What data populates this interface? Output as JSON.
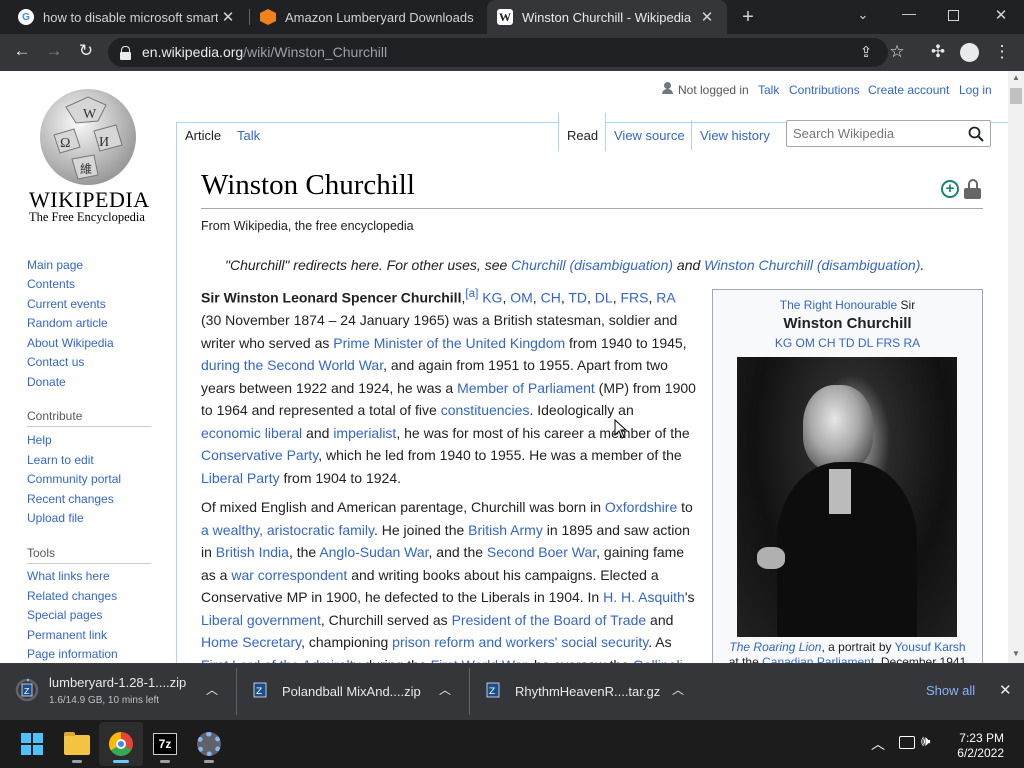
{
  "browser": {
    "tabs": [
      {
        "title": "how to disable microsoft smartsc",
        "icon": "google-icon"
      },
      {
        "title": "Amazon Lumberyard Downloads",
        "icon": "lumberyard-icon"
      },
      {
        "title": "Winston Churchill - Wikipedia",
        "icon": "wikipedia-icon"
      }
    ],
    "new_tab": "+",
    "url_host": "en.wikipedia.org",
    "url_path": "/wiki/Winston_Churchill"
  },
  "wiki": {
    "logo_word": "WIKIPEDIA",
    "logo_tagline": "The Free Encyclopedia",
    "user": {
      "status": "Not logged in",
      "talk": "Talk",
      "contributions": "Contributions",
      "create": "Create account",
      "login": "Log in"
    },
    "tabs": {
      "article": "Article",
      "talk": "Talk",
      "read": "Read",
      "view_source": "View source",
      "view_history": "View history"
    },
    "search_placeholder": "Search Wikipedia",
    "nav": [
      "Main page",
      "Contents",
      "Current events",
      "Random article",
      "About Wikipedia",
      "Contact us",
      "Donate"
    ],
    "contribute_heading": "Contribute",
    "contribute": [
      "Help",
      "Learn to edit",
      "Community portal",
      "Recent changes",
      "Upload file"
    ],
    "tools_heading": "Tools",
    "tools": [
      "What links here",
      "Related changes",
      "Special pages",
      "Permanent link",
      "Page information"
    ],
    "title": "Winston Churchill",
    "tagline": "From Wikipedia, the free encyclopedia",
    "hatnote": {
      "a": "\"Churchill\" redirects here. For other uses, see ",
      "l1": "Churchill (disambiguation)",
      "b": " and ",
      "l2": "Winston Churchill (disambiguation)",
      "c": "."
    },
    "infobox": {
      "honorific": "The Right Honourable",
      "sir": " Sir",
      "name": "Winston Churchill",
      "postnominals": "KG OM CH TD DL FRS RA",
      "caption_link1": "The Roaring Lion",
      "caption_mid": ", a portrait by ",
      "caption_link2": "Yousuf Karsh",
      "caption_2a": "at the ",
      "caption_link3": "Canadian Parliament",
      "caption_2b": ", December 1941"
    }
  },
  "downloads": {
    "items": [
      {
        "name": "lumberyard-1.28-1....zip",
        "status": "1.6/14.9 GB, 10 mins left"
      },
      {
        "name": "Polandball MixAnd....zip"
      },
      {
        "name": "RhythmHeavenR....tar.gz"
      }
    ],
    "show_all": "Show all"
  },
  "taskbar": {
    "time": "7:23 PM",
    "date": "6/2/2022"
  }
}
